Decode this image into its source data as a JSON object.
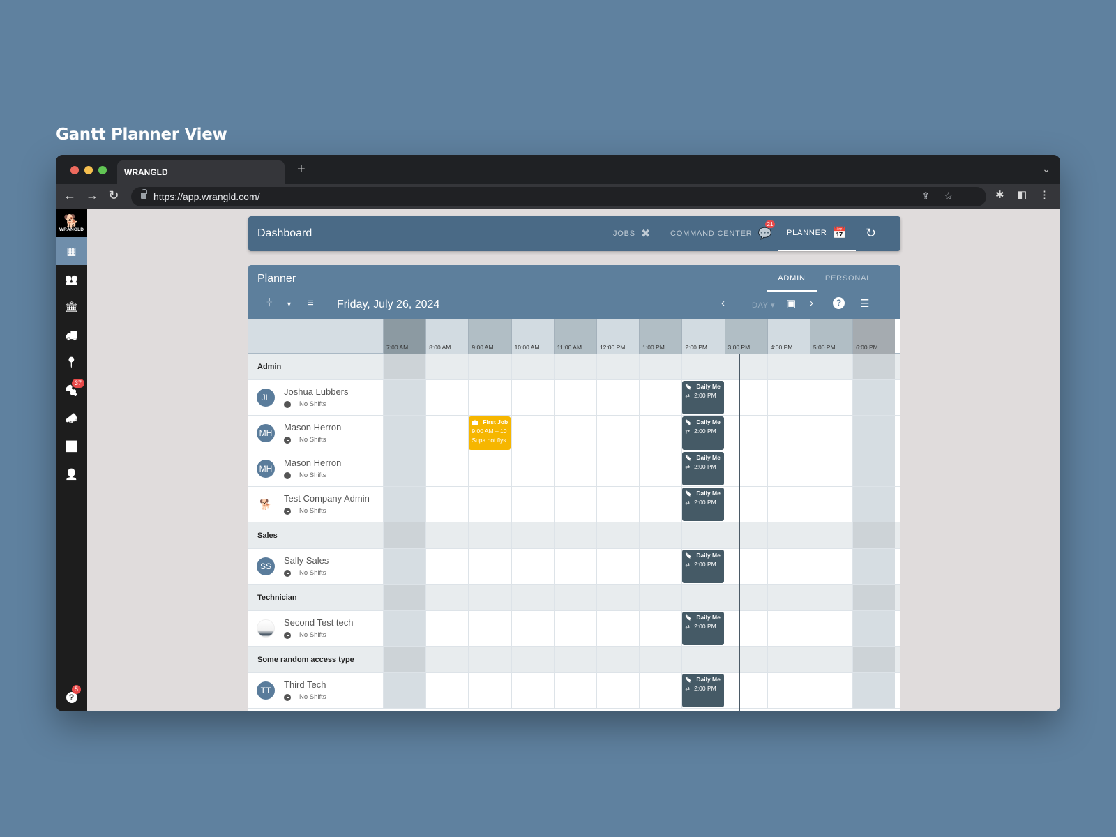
{
  "caption": "Gantt Planner View",
  "browser": {
    "tab_title": "WRANGLD",
    "url": "https://app.wrangld.com/"
  },
  "sidebar": {
    "logo_text": "WRANGLD",
    "items": [
      {
        "icon": "dashboard-icon",
        "glyph": "▦",
        "active": true
      },
      {
        "icon": "users-icon",
        "glyph": "👥"
      },
      {
        "icon": "bank-icon",
        "glyph": "🏛"
      },
      {
        "icon": "truck-icon",
        "glyph": "🚚"
      },
      {
        "icon": "route-icon",
        "glyph": "📍"
      },
      {
        "icon": "drill-icon",
        "glyph": "🔩",
        "badge": "37"
      },
      {
        "icon": "megaphone-icon",
        "glyph": "📣"
      },
      {
        "icon": "report-icon",
        "glyph": "📊"
      },
      {
        "icon": "user-key-icon",
        "glyph": "👤"
      }
    ],
    "help_badge": "5"
  },
  "header": {
    "title": "Dashboard",
    "tabs": [
      {
        "label": "JOBS",
        "icon": "tools-icon"
      },
      {
        "label": "COMMAND CENTER",
        "icon": "chat-icon",
        "badge": "21"
      },
      {
        "label": "PLANNER",
        "icon": "calendar-icon",
        "active": true
      }
    ]
  },
  "planner": {
    "title": "Planner",
    "view_tabs": [
      {
        "label": "ADMIN",
        "active": true
      },
      {
        "label": "PERSONAL"
      }
    ],
    "date": "Friday, July 26, 2024",
    "view_mode": "DAY",
    "hours": [
      "7:00 AM",
      "8:00 AM",
      "9:00 AM",
      "10:00 AM",
      "11:00 AM",
      "12:00 PM",
      "1:00 PM",
      "2:00 PM",
      "3:00 PM",
      "4:00 PM",
      "5:00 PM",
      "6:00 PM"
    ],
    "off_hours": [
      0,
      11
    ],
    "now_hour_fraction": 8.33,
    "groups": [
      {
        "name": "Admin",
        "people": [
          {
            "name": "Joshua Lubbers",
            "initials": "JL",
            "shift": "No Shifts",
            "avatar": "initials"
          },
          {
            "name": "Mason Herron",
            "initials": "MH",
            "shift": "No Shifts",
            "avatar": "initials"
          },
          {
            "name": "Mason Herron",
            "initials": "MH",
            "shift": "No Shifts",
            "avatar": "initials"
          },
          {
            "name": "Test Company Admin",
            "initials": "",
            "shift": "No Shifts",
            "avatar": "logo"
          }
        ]
      },
      {
        "name": "Sales",
        "people": [
          {
            "name": "Sally Sales",
            "initials": "SS",
            "shift": "No Shifts",
            "avatar": "initials"
          }
        ]
      },
      {
        "name": "Technician",
        "people": [
          {
            "name": "Second Test tech",
            "initials": "",
            "shift": "No Shifts",
            "avatar": "photo"
          }
        ]
      },
      {
        "name": "Some random access type",
        "people": [
          {
            "name": "Third Tech",
            "initials": "TT",
            "shift": "No Shifts",
            "avatar": "initials"
          }
        ]
      }
    ],
    "events": {
      "meeting": {
        "title": "Daily Me",
        "time": "2:00 PM",
        "start_hour_index": 7,
        "duration_hours": 1
      },
      "job": {
        "title": "First Job",
        "time": "9:00 AM – 10",
        "note": "Supa hot flys",
        "start_hour_index": 2,
        "duration_hours": 1,
        "row": "Mason Herron"
      }
    }
  },
  "colors": {
    "accent": "#5d7f9c",
    "header": "#4a6a86",
    "meeting": "#455a66",
    "job": "#f6b600",
    "badge": "#e84a4a"
  }
}
